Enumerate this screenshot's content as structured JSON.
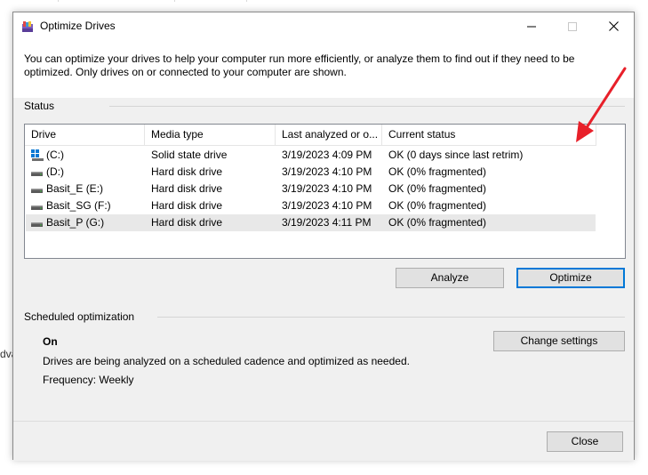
{
  "background": {
    "partial_text": "dva"
  },
  "window": {
    "title": "Optimize Drives",
    "intro_text": "You can optimize your drives to help your computer run more efficiently, or analyze them to find out if they need to be optimized. Only drives on or connected to your computer are shown.",
    "title_buttons": {
      "minimize_icon": "minimize-icon",
      "maximize_icon": "maximize-icon",
      "close_icon": "close-icon"
    }
  },
  "status": {
    "label": "Status",
    "columns": [
      "Drive",
      "Media type",
      "Last analyzed or o...",
      "Current status"
    ],
    "rows": [
      {
        "drive": "(C:)",
        "media": "Solid state drive",
        "last": "3/19/2023 4:09 PM",
        "status": "OK (0 days since last retrim)",
        "icon": "ssd-windows-drive-icon"
      },
      {
        "drive": "(D:)",
        "media": "Hard disk drive",
        "last": "3/19/2023 4:10 PM",
        "status": "OK (0% fragmented)",
        "icon": "hard-disk-icon"
      },
      {
        "drive": "Basit_E (E:)",
        "media": "Hard disk drive",
        "last": "3/19/2023 4:10 PM",
        "status": "OK (0% fragmented)",
        "icon": "hard-disk-icon"
      },
      {
        "drive": "Basit_SG (F:)",
        "media": "Hard disk drive",
        "last": "3/19/2023 4:10 PM",
        "status": "OK (0% fragmented)",
        "icon": "hard-disk-icon"
      },
      {
        "drive": "Basit_P (G:)",
        "media": "Hard disk drive",
        "last": "3/19/2023 4:11 PM",
        "status": "OK (0% fragmented)",
        "icon": "hard-disk-icon",
        "selected": true
      }
    ],
    "analyze_label": "Analyze",
    "optimize_label": "Optimize"
  },
  "scheduled": {
    "label": "Scheduled optimization",
    "state": "On",
    "description": "Drives are being analyzed on a scheduled cadence and optimized as needed.",
    "frequency": "Frequency: Weekly",
    "change_settings_label": "Change settings"
  },
  "footer": {
    "close_label": "Close"
  },
  "annotation": {
    "arrow_color": "#e8202a"
  },
  "colors": {
    "accent": "#0078d7",
    "selected_row": "#e8e8e8",
    "window_bg": "#f0f0f0"
  }
}
